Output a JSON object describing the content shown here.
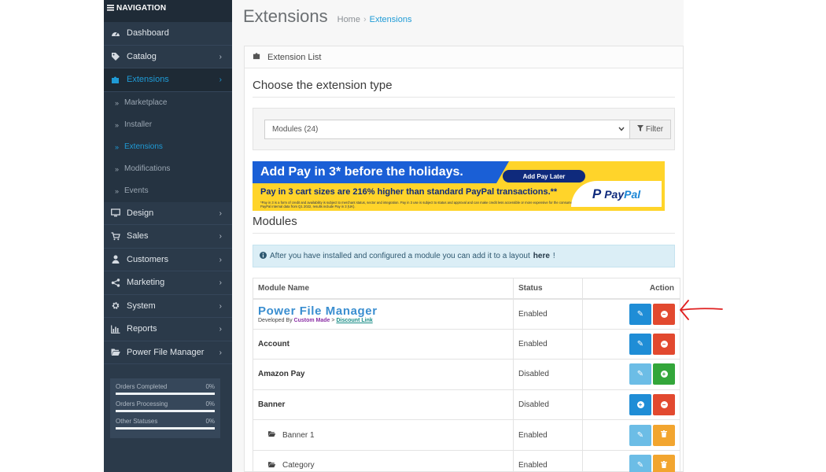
{
  "sidebar": {
    "heading": "NAVIGATION",
    "items": [
      {
        "label": "Dashboard",
        "icon": "dashboard-icon"
      },
      {
        "label": "Catalog",
        "icon": "tags-icon"
      },
      {
        "label": "Extensions",
        "icon": "puzzle-icon"
      },
      {
        "label": "Design",
        "icon": "monitor-icon"
      },
      {
        "label": "Sales",
        "icon": "cart-icon"
      },
      {
        "label": "Customers",
        "icon": "user-icon"
      },
      {
        "label": "Marketing",
        "icon": "share-icon"
      },
      {
        "label": "System",
        "icon": "gear-icon"
      },
      {
        "label": "Reports",
        "icon": "bar-chart-icon"
      },
      {
        "label": "Power File Manager",
        "icon": "folder-open-icon"
      }
    ],
    "sub_items": [
      "Marketplace",
      "Installer",
      "Extensions",
      "Modifications",
      "Events"
    ],
    "stats": [
      {
        "label": "Orders Completed",
        "value": "0%"
      },
      {
        "label": "Orders Processing",
        "value": "0%"
      },
      {
        "label": "Other Statuses",
        "value": "0%"
      }
    ]
  },
  "header": {
    "title": "Extensions",
    "breadcrumb": [
      "Home",
      "Extensions"
    ]
  },
  "panel": {
    "heading": "Extension List",
    "choose_title": "Choose the extension type",
    "select_value": "Modules (24)",
    "filter_label": "Filter"
  },
  "banner": {
    "headline": "Add Pay in 3* before the holidays.",
    "cta": "Add Pay Later",
    "subline": "Pay in 3 cart sizes are 216% higher than standard PayPal transactions.**",
    "fine_print": "*Pay in 3 is a form of credit and availability is subject to merchant status, sector and integration. Pay in 3 use is subject to status and approval and can make credit less accessible or more expensive for the consumer. See product terms for more details. **Based on PayPal internal data from Q1 2022, results include Pay in 3 (UK).",
    "logo_pay": "Pay",
    "logo_pal": "Pal"
  },
  "modules": {
    "title": "Modules",
    "alert_text": "After you have installed and configured a module you can add it to a layout",
    "alert_link": "here",
    "alert_end": "!",
    "columns": [
      "Module Name",
      "Status",
      "Action"
    ],
    "pfm": {
      "name": "Power File Manager",
      "developed_by": "Developed By",
      "author": "Custom Made",
      "sep": ">",
      "link": "Discount Link",
      "status": "Enabled"
    },
    "rows": [
      {
        "name": "Account",
        "status": "Enabled"
      },
      {
        "name": "Amazon Pay",
        "status": "Disabled"
      },
      {
        "name": "Banner",
        "status": "Disabled"
      },
      {
        "name": "Banner 1",
        "status": "Enabled"
      },
      {
        "name": "Category",
        "status": "Enabled"
      }
    ]
  },
  "colors": {
    "sidebar_bg": "#2b3a4a",
    "accent": "#1f9bd6",
    "danger": "#e2492f",
    "success": "#33a63a",
    "warning": "#f2a52f",
    "annotation": "#e02020"
  }
}
